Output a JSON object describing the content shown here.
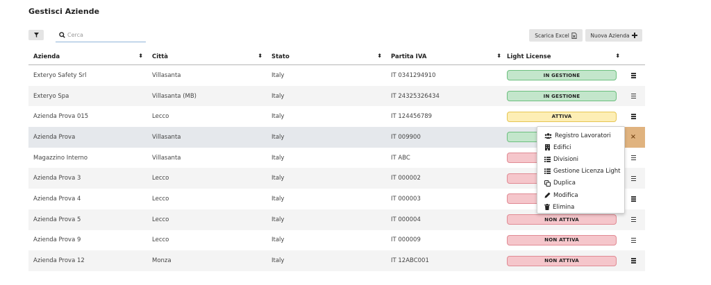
{
  "header": {
    "title": "Gestisci Aziende"
  },
  "toolbar": {
    "search_placeholder": "Cerca",
    "excel_label": "Scarica Excel",
    "new_label": "Nuova Azienda"
  },
  "table": {
    "columns": [
      "Azienda",
      "Città",
      "Stato",
      "Partita IVA",
      "Light License"
    ],
    "rows": [
      {
        "azienda": "Exteryo Safety Srl",
        "citta": "Villasanta",
        "stato": "Italy",
        "piva": "IT 0341294910",
        "license": "IN GESTIONE",
        "license_state": "green"
      },
      {
        "azienda": "Exteryo Spa",
        "citta": "Villasanta (MB)",
        "stato": "Italy",
        "piva": "IT 24325326434",
        "license": "IN GESTIONE",
        "license_state": "green"
      },
      {
        "azienda": "Azienda Prova 015",
        "citta": "Lecco",
        "stato": "Italy",
        "piva": "IT 124456789",
        "license": "ATTIVA",
        "license_state": "yellow"
      },
      {
        "azienda": "Azienda Prova",
        "citta": "Villasanta",
        "stato": "Italy",
        "piva": "IT 009900",
        "license": "",
        "license_state": "green"
      },
      {
        "azienda": "Magazzino Interno",
        "citta": "Villasanta",
        "stato": "Italy",
        "piva": "IT ABC",
        "license": "",
        "license_state": "red"
      },
      {
        "azienda": "Azienda Prova 3",
        "citta": "Lecco",
        "stato": "Italy",
        "piva": "IT 000002",
        "license": "",
        "license_state": "red"
      },
      {
        "azienda": "Azienda Prova 4",
        "citta": "Lecco",
        "stato": "Italy",
        "piva": "IT 000003",
        "license": "",
        "license_state": "red"
      },
      {
        "azienda": "Azienda Prova 5",
        "citta": "Lecco",
        "stato": "Italy",
        "piva": "IT 000004",
        "license": "NON ATTIVA",
        "license_state": "red"
      },
      {
        "azienda": "Azienda Prova 9",
        "citta": "Lecco",
        "stato": "Italy",
        "piva": "IT 000009",
        "license": "NON ATTIVA",
        "license_state": "red"
      },
      {
        "azienda": "Azienda Prova 12",
        "citta": "Monza",
        "stato": "Italy",
        "piva": "IT 12ABC001",
        "license": "NON ATTIVA",
        "license_state": "red"
      }
    ]
  },
  "context_menu": {
    "items": [
      {
        "label": "Registro Lavoratori",
        "icon": "users-icon"
      },
      {
        "label": "Edifici",
        "icon": "building-icon"
      },
      {
        "label": "Divisioni",
        "icon": "list-icon"
      },
      {
        "label": "Gestione Licenza Light",
        "icon": "list-icon"
      },
      {
        "label": "Duplica",
        "icon": "copy-icon"
      },
      {
        "label": "Modifica",
        "icon": "pencil-icon"
      },
      {
        "label": "Elimina",
        "icon": "trash-icon"
      }
    ]
  },
  "colors": {
    "green_bg": "#c3e6cb",
    "yellow_bg": "#fdeeb5",
    "red_bg": "#f5c6cb",
    "active_action": "#e0b37f"
  }
}
